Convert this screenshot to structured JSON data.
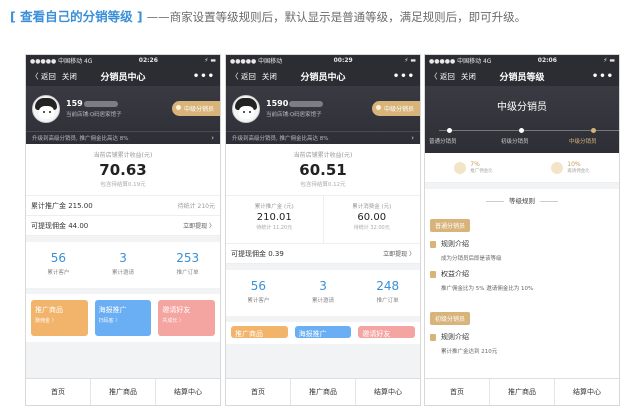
{
  "caption": {
    "part1": "[ 查看自己的分销等级 ]",
    "part2": "——商家设置等级规则后，默认显示是普通等级，满足规则后，即可升级。"
  },
  "phones": [
    {
      "status": {
        "carrier": "●●●●● 中国移动  4G",
        "time": "02:26",
        "battery": "⚡ ▬"
      },
      "nav": {
        "back": "〈 返回",
        "close": "关闭",
        "title": "分销员中心",
        "more": "•••"
      },
      "profile": {
        "phone_prefix": "159",
        "shop": "当前店铺:Q码居家馆子",
        "level": "中级分销员"
      },
      "upgrade": "升级到高级分销员, 推广佣金比高达 8%",
      "income": {
        "label": "当前店铺累计收益(元)",
        "amount": "70.63",
        "sub": "包含待结算0.19元"
      },
      "rows": [
        {
          "left": "累计推广金 215.00",
          "right": "待统计 210元"
        },
        {
          "left": "可提现佣金  44.00",
          "right": "立即提现  〉"
        }
      ],
      "stats": [
        {
          "n": "56",
          "l": "累计客户"
        },
        {
          "n": "3",
          "l": "累计邀请"
        },
        {
          "n": "253",
          "l": "推广订单"
        }
      ],
      "tiles": [
        {
          "t": "推广商品",
          "s": "赚佣金 〉"
        },
        {
          "t": "海报推广",
          "s": "扫码客 〉"
        },
        {
          "t": "邀请好友",
          "s": "共成长 〉"
        }
      ],
      "tabs": [
        "首页",
        "推广商品",
        "结算中心"
      ]
    },
    {
      "status": {
        "carrier": "●●●●● 中国移动  ",
        "time": "00:29",
        "battery": "⚡ ▬"
      },
      "nav": {
        "back": "〈 返回",
        "close": "关闭",
        "title": "分销员中心",
        "more": "•••"
      },
      "profile": {
        "phone_prefix": "1590",
        "shop": "当前店铺:Q码居家馆子",
        "level": "中级分销员"
      },
      "upgrade": "升级到高级分销员, 推广佣金比高达 8%",
      "income": {
        "label": "当前店铺累计收益(元)",
        "amount": "60.51",
        "sub": "包含待结算0.12元"
      },
      "split": [
        {
          "lbl": "累计推广金 (元)",
          "v": "210.01",
          "s": "待统计 11.20元"
        },
        {
          "lbl": "累计消费金 (元)",
          "v": "60.00",
          "s": "待统计 32.00元"
        }
      ],
      "withdraw": {
        "left": "可提现佣金 0.39",
        "right": "立即提现  〉"
      },
      "stats": [
        {
          "n": "56",
          "l": "累计客户"
        },
        {
          "n": "3",
          "l": "累计邀请"
        },
        {
          "n": "248",
          "l": "推广订单"
        }
      ],
      "tiles": [
        {
          "t": "推广商品",
          "s": ""
        },
        {
          "t": "海报推广",
          "s": ""
        },
        {
          "t": "邀请好友",
          "s": ""
        }
      ],
      "tabs": [
        "首页",
        "推广商品",
        "结算中心"
      ]
    },
    {
      "status": {
        "carrier": "●●●●● 中国移动  4G",
        "time": "02:06",
        "battery": "⚡ ▬"
      },
      "nav": {
        "back": "〈 返回",
        "close": "关闭",
        "title": "分销员等级",
        "more": "•••"
      },
      "level_title": "中级分销员",
      "levels": [
        "普通分销员",
        "初级分销员",
        "中级分销员"
      ],
      "perks": [
        {
          "v": "7%",
          "l": "推广佣金比"
        },
        {
          "v": "10%",
          "l": "邀请佣金比"
        }
      ],
      "rules_title": "等级规则",
      "rule_groups": [
        {
          "tag": "普通分销员",
          "items": [
            {
              "head": "规则介绍",
              "text": "成为分销员后即是该等级"
            },
            {
              "head": "权益介绍",
              "text": "推广佣金比为 5%   邀请佣金比为 10%"
            }
          ]
        },
        {
          "tag": "初级分销员",
          "items": [
            {
              "head": "规则介绍",
              "text": "累计推广金达到 210元"
            }
          ]
        }
      ],
      "tabs": [
        "首页",
        "推广商品",
        "结算中心"
      ]
    }
  ]
}
